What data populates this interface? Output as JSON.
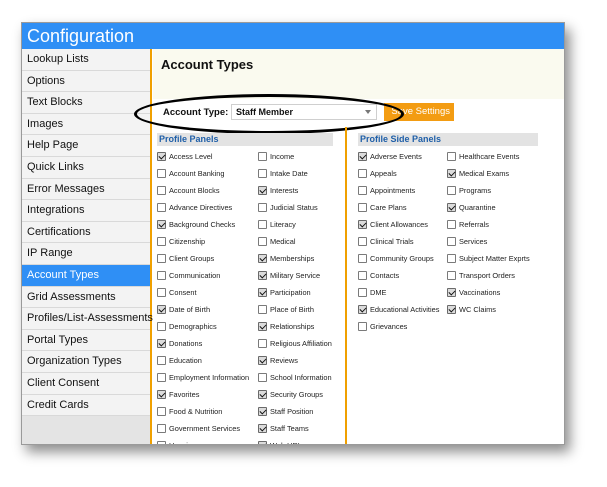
{
  "window": {
    "title": "Configuration"
  },
  "sidebar": {
    "items": [
      {
        "label": "Lookup Lists",
        "active": false
      },
      {
        "label": "Options",
        "active": false
      },
      {
        "label": "Text Blocks",
        "active": false
      },
      {
        "label": "Images",
        "active": false
      },
      {
        "label": "Help Page",
        "active": false
      },
      {
        "label": "Quick Links",
        "active": false
      },
      {
        "label": "Error Messages",
        "active": false
      },
      {
        "label": "Integrations",
        "active": false
      },
      {
        "label": "Certifications",
        "active": false
      },
      {
        "label": "IP Range",
        "active": false
      },
      {
        "label": "Account Types",
        "active": true
      },
      {
        "label": "Grid Assessments",
        "active": false
      },
      {
        "label": "Profiles/List-Assessments",
        "active": false
      },
      {
        "label": "Portal Types",
        "active": false
      },
      {
        "label": "Organization Types",
        "active": false
      },
      {
        "label": "Client Consent",
        "active": false
      },
      {
        "label": "Credit Cards",
        "active": false
      }
    ]
  },
  "main": {
    "title": "Account Types",
    "account_type_label": "Account Type:",
    "account_type_value": "Staff Member",
    "save_label": "Save Settings"
  },
  "profile_panels": {
    "header": "Profile Panels",
    "col_a": [
      {
        "label": "Access Level",
        "checked": true
      },
      {
        "label": "Account Banking",
        "checked": false
      },
      {
        "label": "Account Blocks",
        "checked": false
      },
      {
        "label": "Advance Directives",
        "checked": false
      },
      {
        "label": "Background Checks",
        "checked": true
      },
      {
        "label": "Citizenship",
        "checked": false
      },
      {
        "label": "Client Groups",
        "checked": false
      },
      {
        "label": "Communication",
        "checked": false
      },
      {
        "label": "Consent",
        "checked": false
      },
      {
        "label": "Date of Birth",
        "checked": true
      },
      {
        "label": "Demographics",
        "checked": false
      },
      {
        "label": "Donations",
        "checked": true
      },
      {
        "label": "Education",
        "checked": false
      },
      {
        "label": "Employment Information",
        "checked": false
      },
      {
        "label": "Favorites",
        "checked": true
      },
      {
        "label": "Food & Nutrition",
        "checked": false
      },
      {
        "label": "Government Services",
        "checked": false
      },
      {
        "label": "Housing",
        "checked": false
      }
    ],
    "col_b": [
      {
        "label": "Income",
        "checked": false
      },
      {
        "label": "Intake Date",
        "checked": false
      },
      {
        "label": "Interests",
        "checked": true
      },
      {
        "label": "Judicial Status",
        "checked": false
      },
      {
        "label": "Literacy",
        "checked": false
      },
      {
        "label": "Medical",
        "checked": false
      },
      {
        "label": "Memberships",
        "checked": true
      },
      {
        "label": "Military Service",
        "checked": true
      },
      {
        "label": "Participation",
        "checked": true
      },
      {
        "label": "Place of Birth",
        "checked": false
      },
      {
        "label": "Relationships",
        "checked": true
      },
      {
        "label": "Religious Affiliation",
        "checked": false
      },
      {
        "label": "Reviews",
        "checked": true
      },
      {
        "label": "School Information",
        "checked": false
      },
      {
        "label": "Security Groups",
        "checked": true
      },
      {
        "label": "Staff Position",
        "checked": true
      },
      {
        "label": "Staff Teams",
        "checked": true
      },
      {
        "label": "Web URL",
        "checked": true
      }
    ]
  },
  "side_panels": {
    "header": "Profile Side Panels",
    "col_a": [
      {
        "label": "Adverse Events",
        "checked": true
      },
      {
        "label": "Appeals",
        "checked": false
      },
      {
        "label": "Appointments",
        "checked": false
      },
      {
        "label": "Care Plans",
        "checked": false
      },
      {
        "label": "Client Allowances",
        "checked": true
      },
      {
        "label": "Clinical Trials",
        "checked": false
      },
      {
        "label": "Community Groups",
        "checked": false
      },
      {
        "label": "Contacts",
        "checked": false
      },
      {
        "label": "DME",
        "checked": false
      },
      {
        "label": "Educational Activities",
        "checked": true
      },
      {
        "label": "Grievances",
        "checked": false
      }
    ],
    "col_b": [
      {
        "label": "Healthcare Events",
        "checked": false
      },
      {
        "label": "Medical Exams",
        "checked": true
      },
      {
        "label": "Programs",
        "checked": false
      },
      {
        "label": "Quarantine",
        "checked": true
      },
      {
        "label": "Referrals",
        "checked": false
      },
      {
        "label": "Services",
        "checked": false
      },
      {
        "label": "Subject Matter Exprts",
        "checked": false
      },
      {
        "label": "Transport Orders",
        "checked": false
      },
      {
        "label": "Vaccinations",
        "checked": true
      },
      {
        "label": "WC Claims",
        "checked": true
      }
    ]
  },
  "colors": {
    "title_bar": "#2f8ff5",
    "active_nav": "#2f8ff5",
    "accent": "#f0a000",
    "save_button": "#f39c12",
    "panel_header_text": "#1f5fa8"
  },
  "icons": {
    "dropdown": "chevron-down-icon",
    "check": "checkmark-icon"
  }
}
